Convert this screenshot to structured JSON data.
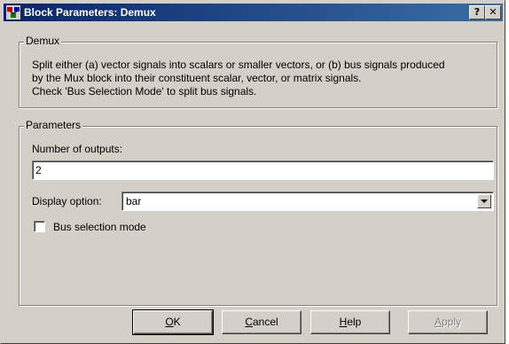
{
  "window": {
    "title": "Block Parameters: Demux",
    "help_button": "?",
    "close_button": "✕"
  },
  "demux_group": {
    "legend": "Demux",
    "description": [
      "Split either (a) vector signals into scalars or smaller vectors, or (b) bus signals produced",
      "by the Mux block into their constituent scalar, vector, or matrix signals.",
      "Check 'Bus Selection Mode' to split bus signals."
    ]
  },
  "parameters_group": {
    "legend": "Parameters",
    "num_outputs_label": "Number of outputs:",
    "num_outputs_value": "2",
    "display_option_label": "Display option:",
    "display_option_value": "bar",
    "bus_selection_label": "Bus selection mode",
    "bus_selection_checked": false
  },
  "buttons": {
    "ok_first": "O",
    "ok_rest": "K",
    "cancel_first": "C",
    "cancel_rest": "ancel",
    "help_first": "H",
    "help_rest": "elp",
    "apply_first": "A",
    "apply_rest": "pply"
  },
  "colors": {
    "titlebar_start": "#0a246a",
    "titlebar_end": "#3a6ea5",
    "dialog_face": "#d4d0c8"
  }
}
